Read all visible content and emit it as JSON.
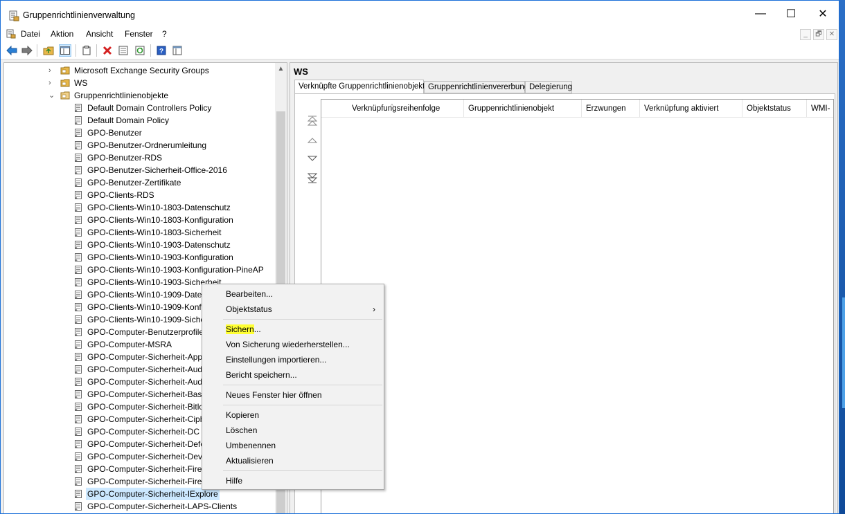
{
  "window": {
    "title": "Gruppenrichtlinienverwaltung",
    "caption_buttons": [
      "—",
      "☐",
      "✕"
    ]
  },
  "menubar": {
    "items": [
      "Datei",
      "Aktion",
      "Ansicht",
      "Fenster",
      "?"
    ],
    "mdi_buttons": [
      "_",
      "🗗",
      "✕"
    ]
  },
  "toolbar": {
    "buttons": [
      "back-icon",
      "forward-icon",
      "up-folder-icon",
      "show-hide-tree-icon",
      "clipboard-icon",
      "delete-icon",
      "properties-icon",
      "refresh-icon",
      "help-icon",
      "console-view-icon"
    ]
  },
  "tree": {
    "parents": [
      {
        "label": "Microsoft Exchange Security Groups",
        "expanded": false
      },
      {
        "label": "WS",
        "expanded": false
      },
      {
        "label": "Gruppenrichtlinienobjekte",
        "expanded": true
      }
    ],
    "gpos": [
      "Default Domain Controllers Policy",
      "Default Domain Policy",
      "GPO-Benutzer",
      "GPO-Benutzer-Ordnerumleitung",
      "GPO-Benutzer-RDS",
      "GPO-Benutzer-Sicherheit-Office-2016",
      "GPO-Benutzer-Zertifikate",
      "GPO-Clients-RDS",
      "GPO-Clients-Win10-1803-Datenschutz",
      "GPO-Clients-Win10-1803-Konfiguration",
      "GPO-Clients-Win10-1803-Sicherheit",
      "GPO-Clients-Win10-1903-Datenschutz",
      "GPO-Clients-Win10-1903-Konfiguration",
      "GPO-Clients-Win10-1903-Konfiguration-PineAP",
      "GPO-Clients-Win10-1903-Sicherheit",
      "GPO-Clients-Win10-1909-Daten",
      "GPO-Clients-Win10-1909-Konfi",
      "GPO-Clients-Win10-1909-Siche",
      "GPO-Computer-Benutzerprofile",
      "GPO-Computer-MSRA",
      "GPO-Computer-Sicherheit-App",
      "GPO-Computer-Sicherheit-Aud",
      "GPO-Computer-Sicherheit-Aud",
      "GPO-Computer-Sicherheit-Basi",
      "GPO-Computer-Sicherheit-Bitlo",
      "GPO-Computer-Sicherheit-Ciph",
      "GPO-Computer-Sicherheit-DC",
      "GPO-Computer-Sicherheit-Defe",
      "GPO-Computer-Sicherheit-Dev",
      "GPO-Computer-Sicherheit-Firet",
      "GPO-Computer-Sicherheit-Firev",
      "GPO-Computer-Sicherheit-IExplore",
      "GPO-Computer-Sicherheit-LAPS-Clients"
    ],
    "selected": "GPO-Computer-Sicherheit-IExplore"
  },
  "detail": {
    "heading": "WS",
    "tabs": [
      "Verknüpfte Gruppenrichtlinienobjekte",
      "Gruppenrichtlinienvererbung",
      "Delegierung"
    ],
    "active_tab": "Verknüpfte Gruppenrichtlinienobjekte",
    "columns": [
      "Verknüpfungsreihenfolge",
      "Gruppenrichtlinienobjekt",
      "Erzwungen",
      "Verknüpfung aktiviert",
      "Objektstatus",
      "WMI-"
    ],
    "order_buttons": [
      "move-top-icon",
      "move-up-icon",
      "move-down-icon",
      "move-bottom-icon"
    ]
  },
  "context_menu": {
    "groups": [
      [
        {
          "label": "Bearbeiten...",
          "submenu": false
        },
        {
          "label": "Objektstatus",
          "submenu": true
        }
      ],
      [
        {
          "label": "Sichern...",
          "submenu": false,
          "highlighted_part": "Sichern",
          "rest": "..."
        },
        {
          "label": "Von Sicherung wiederherstellen...",
          "submenu": false
        },
        {
          "label": "Einstellungen importieren...",
          "submenu": false
        },
        {
          "label": "Bericht speichern...",
          "submenu": false
        }
      ],
      [
        {
          "label": "Neues Fenster hier öffnen",
          "submenu": false
        }
      ],
      [
        {
          "label": "Kopieren",
          "submenu": false
        },
        {
          "label": "Löschen",
          "submenu": false
        },
        {
          "label": "Umbenennen",
          "submenu": false
        },
        {
          "label": "Aktualisieren",
          "submenu": false
        }
      ],
      [
        {
          "label": "Hilfe",
          "submenu": false
        }
      ]
    ],
    "highlight_color": "#ffff33",
    "submenu_arrow": "›"
  },
  "colors": {
    "selection": "#cce8ff",
    "folder": "#e8b84a",
    "window_border": "#1a6fd8"
  }
}
